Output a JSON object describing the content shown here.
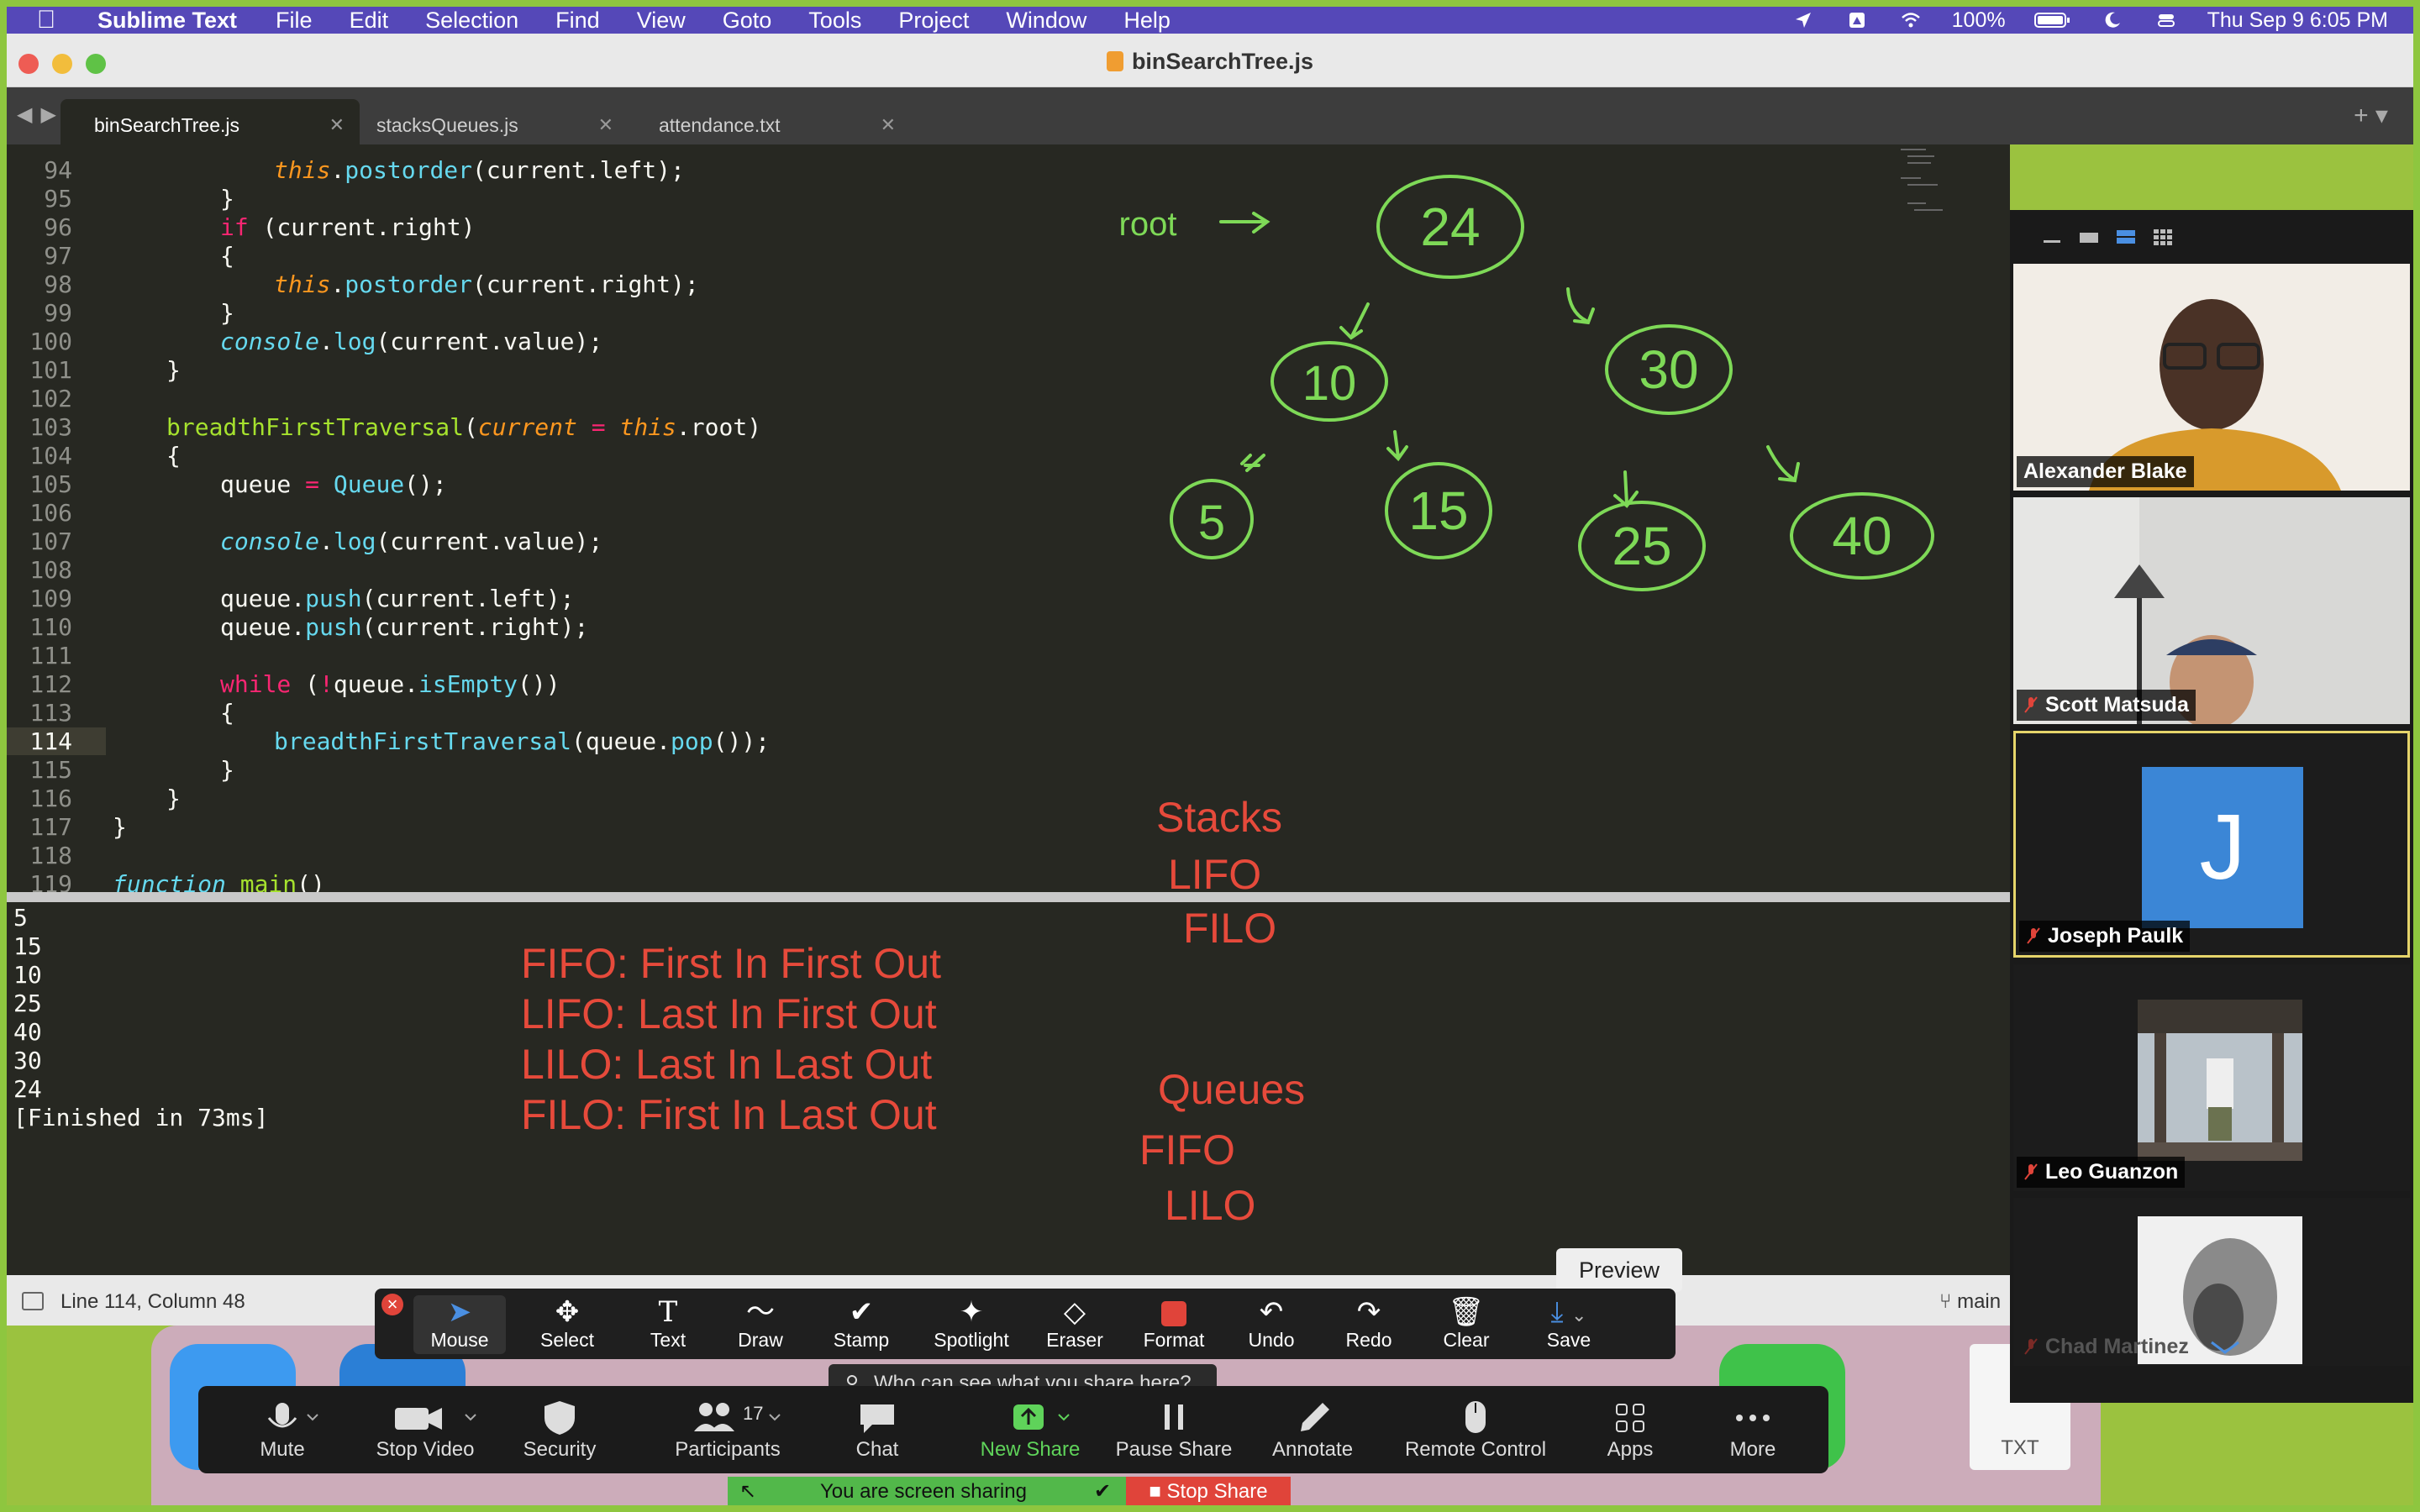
{
  "menubar": {
    "app_name": "Sublime Text",
    "items": [
      "File",
      "Edit",
      "Selection",
      "Find",
      "View",
      "Goto",
      "Tools",
      "Project",
      "Window",
      "Help"
    ],
    "battery": "100%",
    "datetime": "Thu Sep 9  6:05 PM"
  },
  "window": {
    "title": "binSearchTree.js"
  },
  "tabs": [
    {
      "label": "binSearchTree.js"
    },
    {
      "label": "stacksQueues.js"
    },
    {
      "label": "attendance.txt"
    }
  ],
  "editor": {
    "lines": [
      {
        "n": "94",
        "code": "this.postorder(current.left);"
      },
      {
        "n": "95",
        "code": "}"
      },
      {
        "n": "96",
        "code": "if (current.right)"
      },
      {
        "n": "97",
        "code": "{"
      },
      {
        "n": "98",
        "code": "this.postorder(current.right);"
      },
      {
        "n": "99",
        "code": "}"
      },
      {
        "n": "100",
        "code": "console.log(current.value);"
      },
      {
        "n": "101",
        "code": "}"
      },
      {
        "n": "102",
        "code": ""
      },
      {
        "n": "103",
        "code": "breadthFirstTraversal(current = this.root)"
      },
      {
        "n": "104",
        "code": "{"
      },
      {
        "n": "105",
        "code": "queue = Queue();"
      },
      {
        "n": "106",
        "code": ""
      },
      {
        "n": "107",
        "code": "console.log(current.value);"
      },
      {
        "n": "108",
        "code": ""
      },
      {
        "n": "109",
        "code": "queue.push(current.left);"
      },
      {
        "n": "110",
        "code": "queue.push(current.right);"
      },
      {
        "n": "111",
        "code": ""
      },
      {
        "n": "112",
        "code": "while (!queue.isEmpty())"
      },
      {
        "n": "113",
        "code": "{"
      },
      {
        "n": "114",
        "code": "breadthFirstTraversal(queue.pop());"
      },
      {
        "n": "115",
        "code": "}"
      },
      {
        "n": "116",
        "code": "}"
      },
      {
        "n": "117",
        "code": "}"
      },
      {
        "n": "118",
        "code": ""
      },
      {
        "n": "119",
        "code": "function main()"
      }
    ],
    "current_line": "114"
  },
  "output": {
    "lines": [
      "5",
      "15",
      "10",
      "25",
      "40",
      "30",
      "24",
      "[Finished in 73ms]"
    ]
  },
  "annotations": {
    "definitions": [
      "FIFO: First In First Out",
      "LIFO: Last In First Out",
      "LILO: Last In Last Out",
      "FILO: First In Last Out"
    ],
    "stacks_title": "Stacks",
    "stacks_items": [
      "LIFO",
      "FILO"
    ],
    "queues_title": "Queues",
    "queues_items": [
      "FIFO",
      "LILO"
    ],
    "tree_root_label": "root",
    "tree_nodes": [
      "24",
      "10",
      "30",
      "5",
      "15",
      "25",
      "40"
    ]
  },
  "statusbar": {
    "position": "Line 114, Column 48",
    "branch": "main"
  },
  "participants": [
    {
      "name": "Alexander Blake",
      "muted": false
    },
    {
      "name": "Scott Matsuda",
      "muted": true
    },
    {
      "name": "Joseph Paulk",
      "muted": true,
      "avatar_letter": "J",
      "active": true
    },
    {
      "name": "Leo Guanzon",
      "muted": true
    },
    {
      "name": "Chad Martinez",
      "muted": true
    }
  ],
  "annotate_toolbar": {
    "items": [
      "Mouse",
      "Select",
      "Text",
      "Draw",
      "Stamp",
      "Spotlight",
      "Eraser",
      "Format",
      "Undo",
      "Redo",
      "Clear",
      "Save"
    ],
    "preview_tooltip": "Preview"
  },
  "zoom_controls": {
    "items": [
      "Mute",
      "Stop Video",
      "Security",
      "Participants",
      "Chat",
      "New Share",
      "Pause Share",
      "Annotate",
      "Remote Control",
      "Apps",
      "More"
    ],
    "participants_count": "17",
    "who_can_see": "Who can see what you share here?",
    "sharing_status": "You are screen sharing",
    "stop_share": "Stop Share"
  },
  "dock": {
    "txt_label": "TXT"
  },
  "colors": {
    "annotation_red": "#e64a3b",
    "annotation_green": "#7ed957",
    "menubar": "#5548b8",
    "share_border": "#8ec63f"
  }
}
